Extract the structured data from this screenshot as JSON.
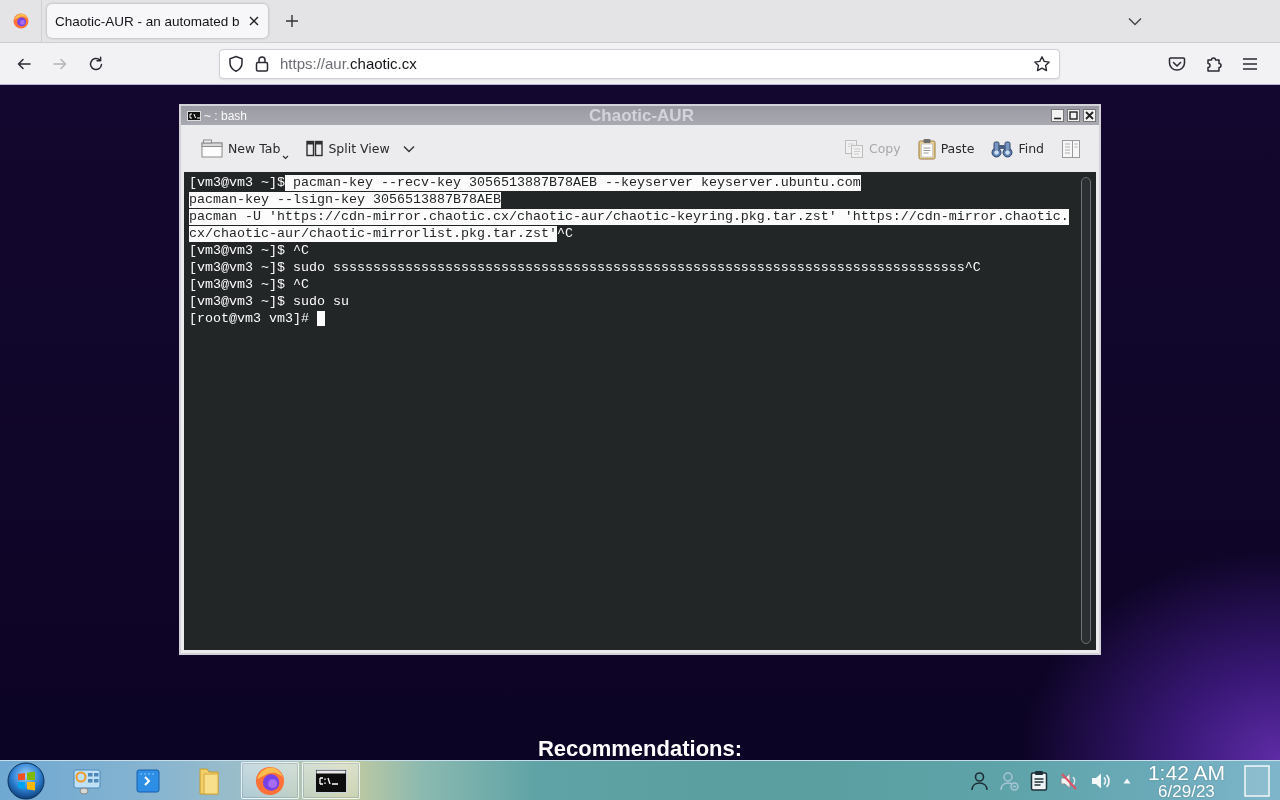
{
  "browser": {
    "tabs": [
      {
        "title": "Chaotic-AUR - an automated b",
        "selected": true
      }
    ],
    "nav_buttons": [
      {
        "kind": "back",
        "disabled": false
      },
      {
        "kind": "forward",
        "disabled": true
      },
      {
        "kind": "reload",
        "disabled": false
      }
    ],
    "address": {
      "url_prefix": "https://aur.",
      "url_domain": "chaotic.cx"
    }
  },
  "page": {
    "title": "Chaotic-AUR",
    "section_heading": "Recommendations:"
  },
  "terminal_window": {
    "title": "~ : bash",
    "toolbar_left": [
      {
        "kind": "new-tab",
        "label": "New Tab",
        "dropdown": true,
        "disabled": false
      },
      {
        "kind": "split-view",
        "label": "Split View",
        "dropdown": true,
        "disabled": false
      }
    ],
    "toolbar_right": [
      {
        "kind": "copy",
        "label": "Copy",
        "dropdown": false,
        "disabled": true
      },
      {
        "kind": "paste",
        "label": "Paste",
        "dropdown": false,
        "disabled": false
      },
      {
        "kind": "find",
        "label": "Find",
        "dropdown": false,
        "disabled": false
      },
      {
        "kind": "panel",
        "dropdown": false,
        "disabled": false
      }
    ],
    "lines": [
      {
        "segments": [
          {
            "text": "[vm3@vm3 ~]$",
            "selected": false
          },
          {
            "text": " pacman-key --recv-key 3056513887B78AEB --keyserver keyserver.ubuntu.com",
            "selected": true
          }
        ],
        "cursor": false
      },
      {
        "segments": [
          {
            "text": "pacman-key --lsign-key 3056513887B78AEB",
            "selected": true
          }
        ],
        "cursor": false
      },
      {
        "segments": [
          {
            "text": "pacman -U 'https://cdn-mirror.chaotic.cx/chaotic-aur/chaotic-keyring.pkg.tar.zst' 'https://cdn-mirror.chaotic.",
            "selected": true
          }
        ],
        "cursor": false
      },
      {
        "segments": [
          {
            "text": "cx/chaotic-aur/chaotic-mirrorlist.pkg.tar.zst'",
            "selected": true
          },
          {
            "text": "^C",
            "selected": false
          }
        ],
        "cursor": false
      },
      {
        "segments": [
          {
            "text": "[vm3@vm3 ~]$ ^C",
            "selected": false
          }
        ],
        "cursor": false
      },
      {
        "segments": [
          {
            "text": "[vm3@vm3 ~]$ sudo sssssssssssssssssssssssssssssssssssssssssssssssssssssssssssssssssssssssssssssss^C",
            "selected": false
          }
        ],
        "cursor": false
      },
      {
        "segments": [
          {
            "text": "[vm3@vm3 ~]$ ^C",
            "selected": false
          }
        ],
        "cursor": false
      },
      {
        "segments": [
          {
            "text": "[vm3@vm3 ~]$ sudo su",
            "selected": false
          }
        ],
        "cursor": false
      },
      {
        "segments": [
          {
            "text": "[root@vm3 vm3]#",
            "selected": false
          }
        ],
        "cursor": true
      }
    ]
  },
  "taskbar": {
    "apps": [
      {
        "kind": "panel",
        "open": false
      },
      {
        "kind": "remote",
        "open": false
      },
      {
        "kind": "folder",
        "open": false
      },
      {
        "kind": "browser",
        "open": true
      },
      {
        "kind": "terminal",
        "open": true
      }
    ],
    "clock": {
      "time": "1:42 AM",
      "date": "6/29/23"
    }
  }
}
